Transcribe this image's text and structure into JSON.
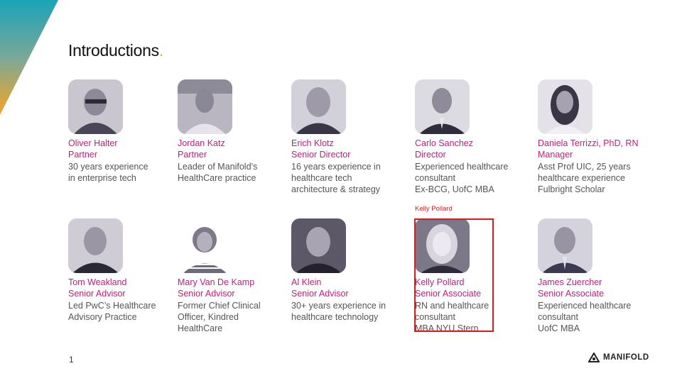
{
  "slide": {
    "title": "Introductions",
    "title_dot": ".",
    "page_number": "1",
    "logo_text": "MANIFOLD",
    "highlight_tag": "Kelly Pollard"
  },
  "people": [
    {
      "name": "Oliver Halter",
      "role": "Partner",
      "desc": "30 years experience\nin enterprise tech"
    },
    {
      "name": "Jordan Katz",
      "role": "Partner",
      "desc": "Leader of Manifold’s\nHealthCare practice"
    },
    {
      "name": "Erich Klotz",
      "role": "Senior Director",
      "desc": "16 years experience in\nhealthcare tech\narchitecture & strategy"
    },
    {
      "name": "Carlo Sanchez",
      "role": "Director",
      "desc": "Experienced healthcare\nconsultant\nEx-BCG, UofC MBA"
    },
    {
      "name": "Daniela Terrizzi, PhD, RN",
      "role": "Manager",
      "desc": "Asst Prof UIC, 25 years\nhealthcare experience\nFulbright Scholar"
    },
    {
      "name": "Tom Weakland",
      "role": "Senior Advisor",
      "desc": "Led PwC’s Healthcare\nAdvisory Practice"
    },
    {
      "name": "Mary Van De Kamp",
      "role": "Senior Advisor",
      "desc": "Former Chief Clinical\nOfficer, Kindred\nHealthCare"
    },
    {
      "name": "Al Klein",
      "role": "Senior Advisor",
      "desc": "30+ years experience in\nhealthcare technology"
    },
    {
      "name": "Kelly Pollard",
      "role": "Senior Associate",
      "desc": "RN and healthcare\nconsultant\nMBA NYU Stern"
    },
    {
      "name": "James Zuercher",
      "role": "Senior Associate",
      "desc": "Experienced healthcare\nconsultant\nUofC MBA"
    }
  ],
  "colors": {
    "accent_pink": "#c8197e",
    "title_dot": "#f5a623",
    "highlight_red": "#d81b1b",
    "corner_gradient": [
      "#1aa3b8",
      "#f5a623"
    ]
  }
}
